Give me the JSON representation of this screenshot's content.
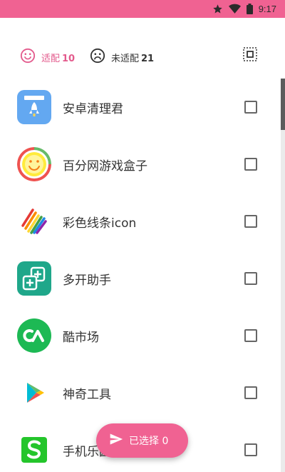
{
  "status_bar": {
    "time": "9:17",
    "background": "#f06292"
  },
  "tabs": {
    "fit": {
      "label": "适配",
      "count": "10",
      "color": "#e35a8c",
      "icon": "smile-icon"
    },
    "unfit": {
      "label": "未适配",
      "count": "21",
      "icon": "sad-face-icon"
    },
    "select_all_icon": "select-all-icon"
  },
  "apps": [
    {
      "name": "安卓清理君",
      "icon": "cleaner-rocket-icon",
      "checked": false
    },
    {
      "name": "百分网游戏盒子",
      "icon": "game-box-smile-icon",
      "checked": false
    },
    {
      "name": "彩色线条icon",
      "icon": "rainbow-lines-icon",
      "checked": false
    },
    {
      "name": "多开助手",
      "icon": "multi-open-icon",
      "checked": false
    },
    {
      "name": "酷市场",
      "icon": "coolmarket-icon",
      "checked": false
    },
    {
      "name": "神奇工具",
      "icon": "play-triangle-icon",
      "checked": false
    },
    {
      "name": "手机乐园",
      "icon": "green-s-icon",
      "checked": false
    }
  ],
  "fab": {
    "label": "已选择",
    "count": "0",
    "color": "#f06292",
    "icon": "send-icon"
  }
}
